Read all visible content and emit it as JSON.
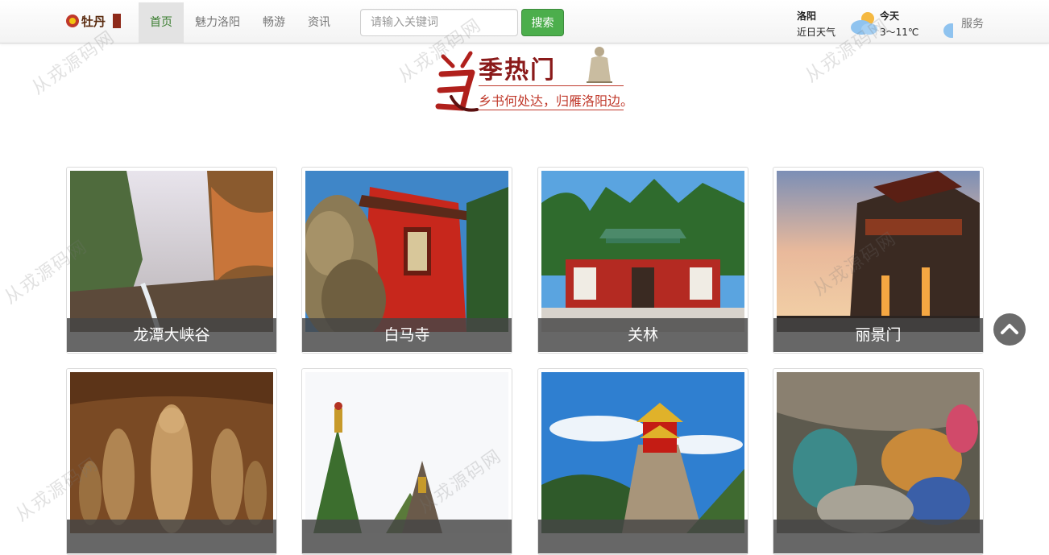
{
  "nav": {
    "links": [
      {
        "label": "首页",
        "active": true
      },
      {
        "label": "魅力洛阳",
        "active": false
      },
      {
        "label": "畅游",
        "active": false
      },
      {
        "label": "资讯",
        "active": false
      }
    ],
    "search_placeholder": "请输入关键词",
    "search_button": "搜索",
    "service": "服务"
  },
  "weather": {
    "city": "洛阳",
    "subtitle": "近日天气",
    "day": "今天",
    "temp": "3～11℃",
    "icon": "partly-cloudy-icon"
  },
  "banner": {
    "title": "季热门",
    "subtitle": "乡书何处达，归雁洛阳边。"
  },
  "attractions": [
    {
      "name": "龙潭大峡谷"
    },
    {
      "name": "白马寺"
    },
    {
      "name": "关林"
    },
    {
      "name": "丽景门"
    },
    {
      "name": ""
    },
    {
      "name": ""
    },
    {
      "name": ""
    },
    {
      "name": ""
    }
  ],
  "watermark": "从戎源码网",
  "colors": {
    "accent_green": "#4cae4c",
    "active_text": "#3a7d2f",
    "banner_red": "#c0392b"
  }
}
